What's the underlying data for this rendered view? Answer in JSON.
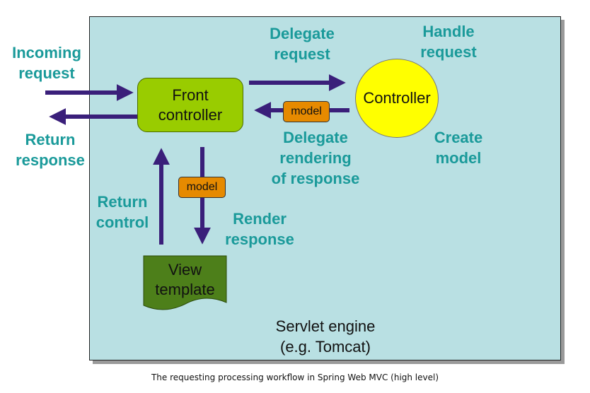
{
  "diagram": {
    "container_label": "Servlet engine\n(e.g. Tomcat)",
    "nodes": {
      "front_controller": "Front\ncontroller",
      "controller": "Controller",
      "view_template": "View\ntemplate",
      "model_top": "model",
      "model_bottom": "model"
    },
    "labels": {
      "incoming_request": "Incoming\nrequest",
      "return_response": "Return\nresponse",
      "delegate_request": "Delegate\nrequest",
      "handle_request": "Handle\nrequest",
      "delegate_rendering": "Delegate\nrendering\nof response",
      "create_model": "Create\nmodel",
      "return_control": "Return\ncontrol",
      "render_response": "Render\nresponse"
    },
    "colors": {
      "container_bg": "#b9e0e3",
      "label_text": "#1a9a9a",
      "arrow": "#3a1f7a",
      "front_controller": "#99cc00",
      "controller": "#ffff00",
      "view_template": "#4d7f1a",
      "model": "#e68a00"
    }
  },
  "caption": "The requesting processing workflow in Spring Web MVC (high level)"
}
